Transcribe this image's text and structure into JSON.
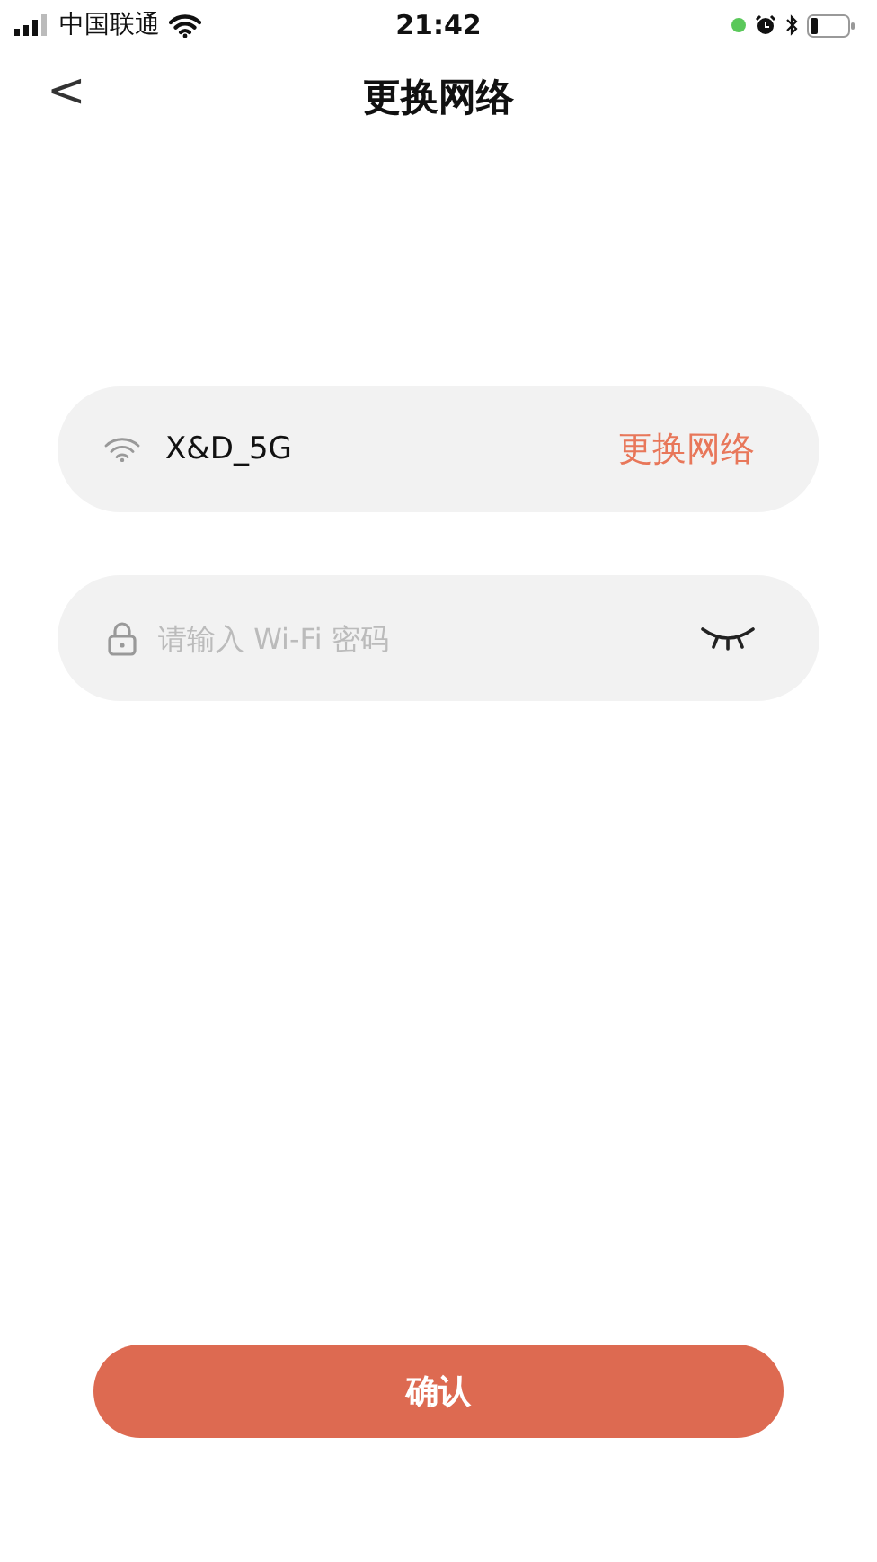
{
  "status_bar": {
    "carrier": "中国联通",
    "time": "21:42"
  },
  "nav": {
    "back": "<",
    "title": "更换网络"
  },
  "network": {
    "name": "X&D_5G",
    "action": "更换网络"
  },
  "password": {
    "placeholder": "请输入 Wi-Fi 密码"
  },
  "confirm": "确认"
}
